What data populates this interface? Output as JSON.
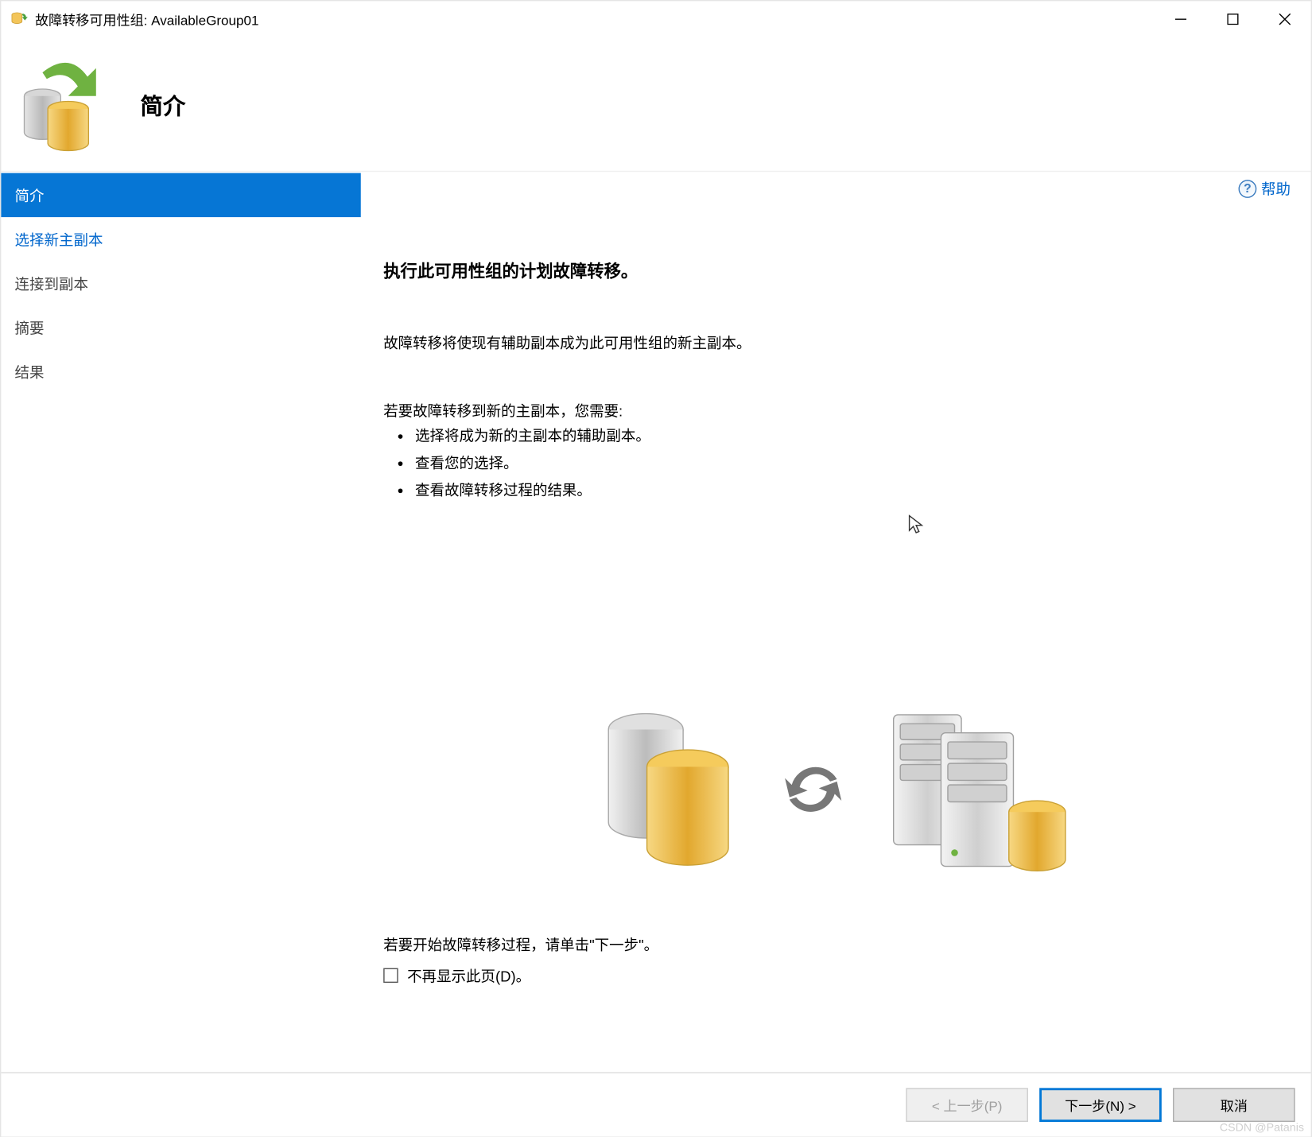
{
  "window": {
    "title": "故障转移可用性组: AvailableGroup01"
  },
  "header": {
    "title": "简介"
  },
  "sidebar": {
    "items": [
      {
        "label": "简介",
        "state": "active"
      },
      {
        "label": "选择新主副本",
        "state": "link"
      },
      {
        "label": "连接到副本",
        "state": "normal"
      },
      {
        "label": "摘要",
        "state": "normal"
      },
      {
        "label": "结果",
        "state": "normal"
      }
    ]
  },
  "content": {
    "help": "帮助",
    "heading": "执行此可用性组的计划故障转移。",
    "paragraph1": "故障转移将使现有辅助副本成为此可用性组的新主副本。",
    "steps_intro": "若要故障转移到新的主副本，您需要:",
    "steps": [
      "选择将成为新的主副本的辅助副本。",
      "查看您的选择。",
      "查看故障转移过程的结果。"
    ],
    "bottom_hint": "若要开始故障转移过程，请单击\"下一步\"。",
    "checkbox_label": "不再显示此页(D)。"
  },
  "footer": {
    "back": "< 上一步(P)",
    "next": "下一步(N) >",
    "cancel": "取消"
  },
  "watermark": "CSDN @Patanis"
}
